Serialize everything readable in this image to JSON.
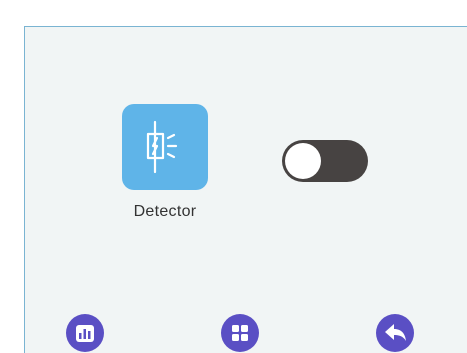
{
  "device": {
    "label": "Detector",
    "icon": "detector-icon",
    "switch_state": "off"
  },
  "nav": {
    "items": [
      {
        "icon": "stats-icon"
      },
      {
        "icon": "grid-icon"
      },
      {
        "icon": "back-arrow-icon"
      }
    ]
  },
  "colors": {
    "tile": "#5fb4e8",
    "toggle_track": "#474342",
    "nav_button": "#5a4fc4",
    "screen_border": "#7ab4d2",
    "screen_background": "#f1f5f5"
  }
}
